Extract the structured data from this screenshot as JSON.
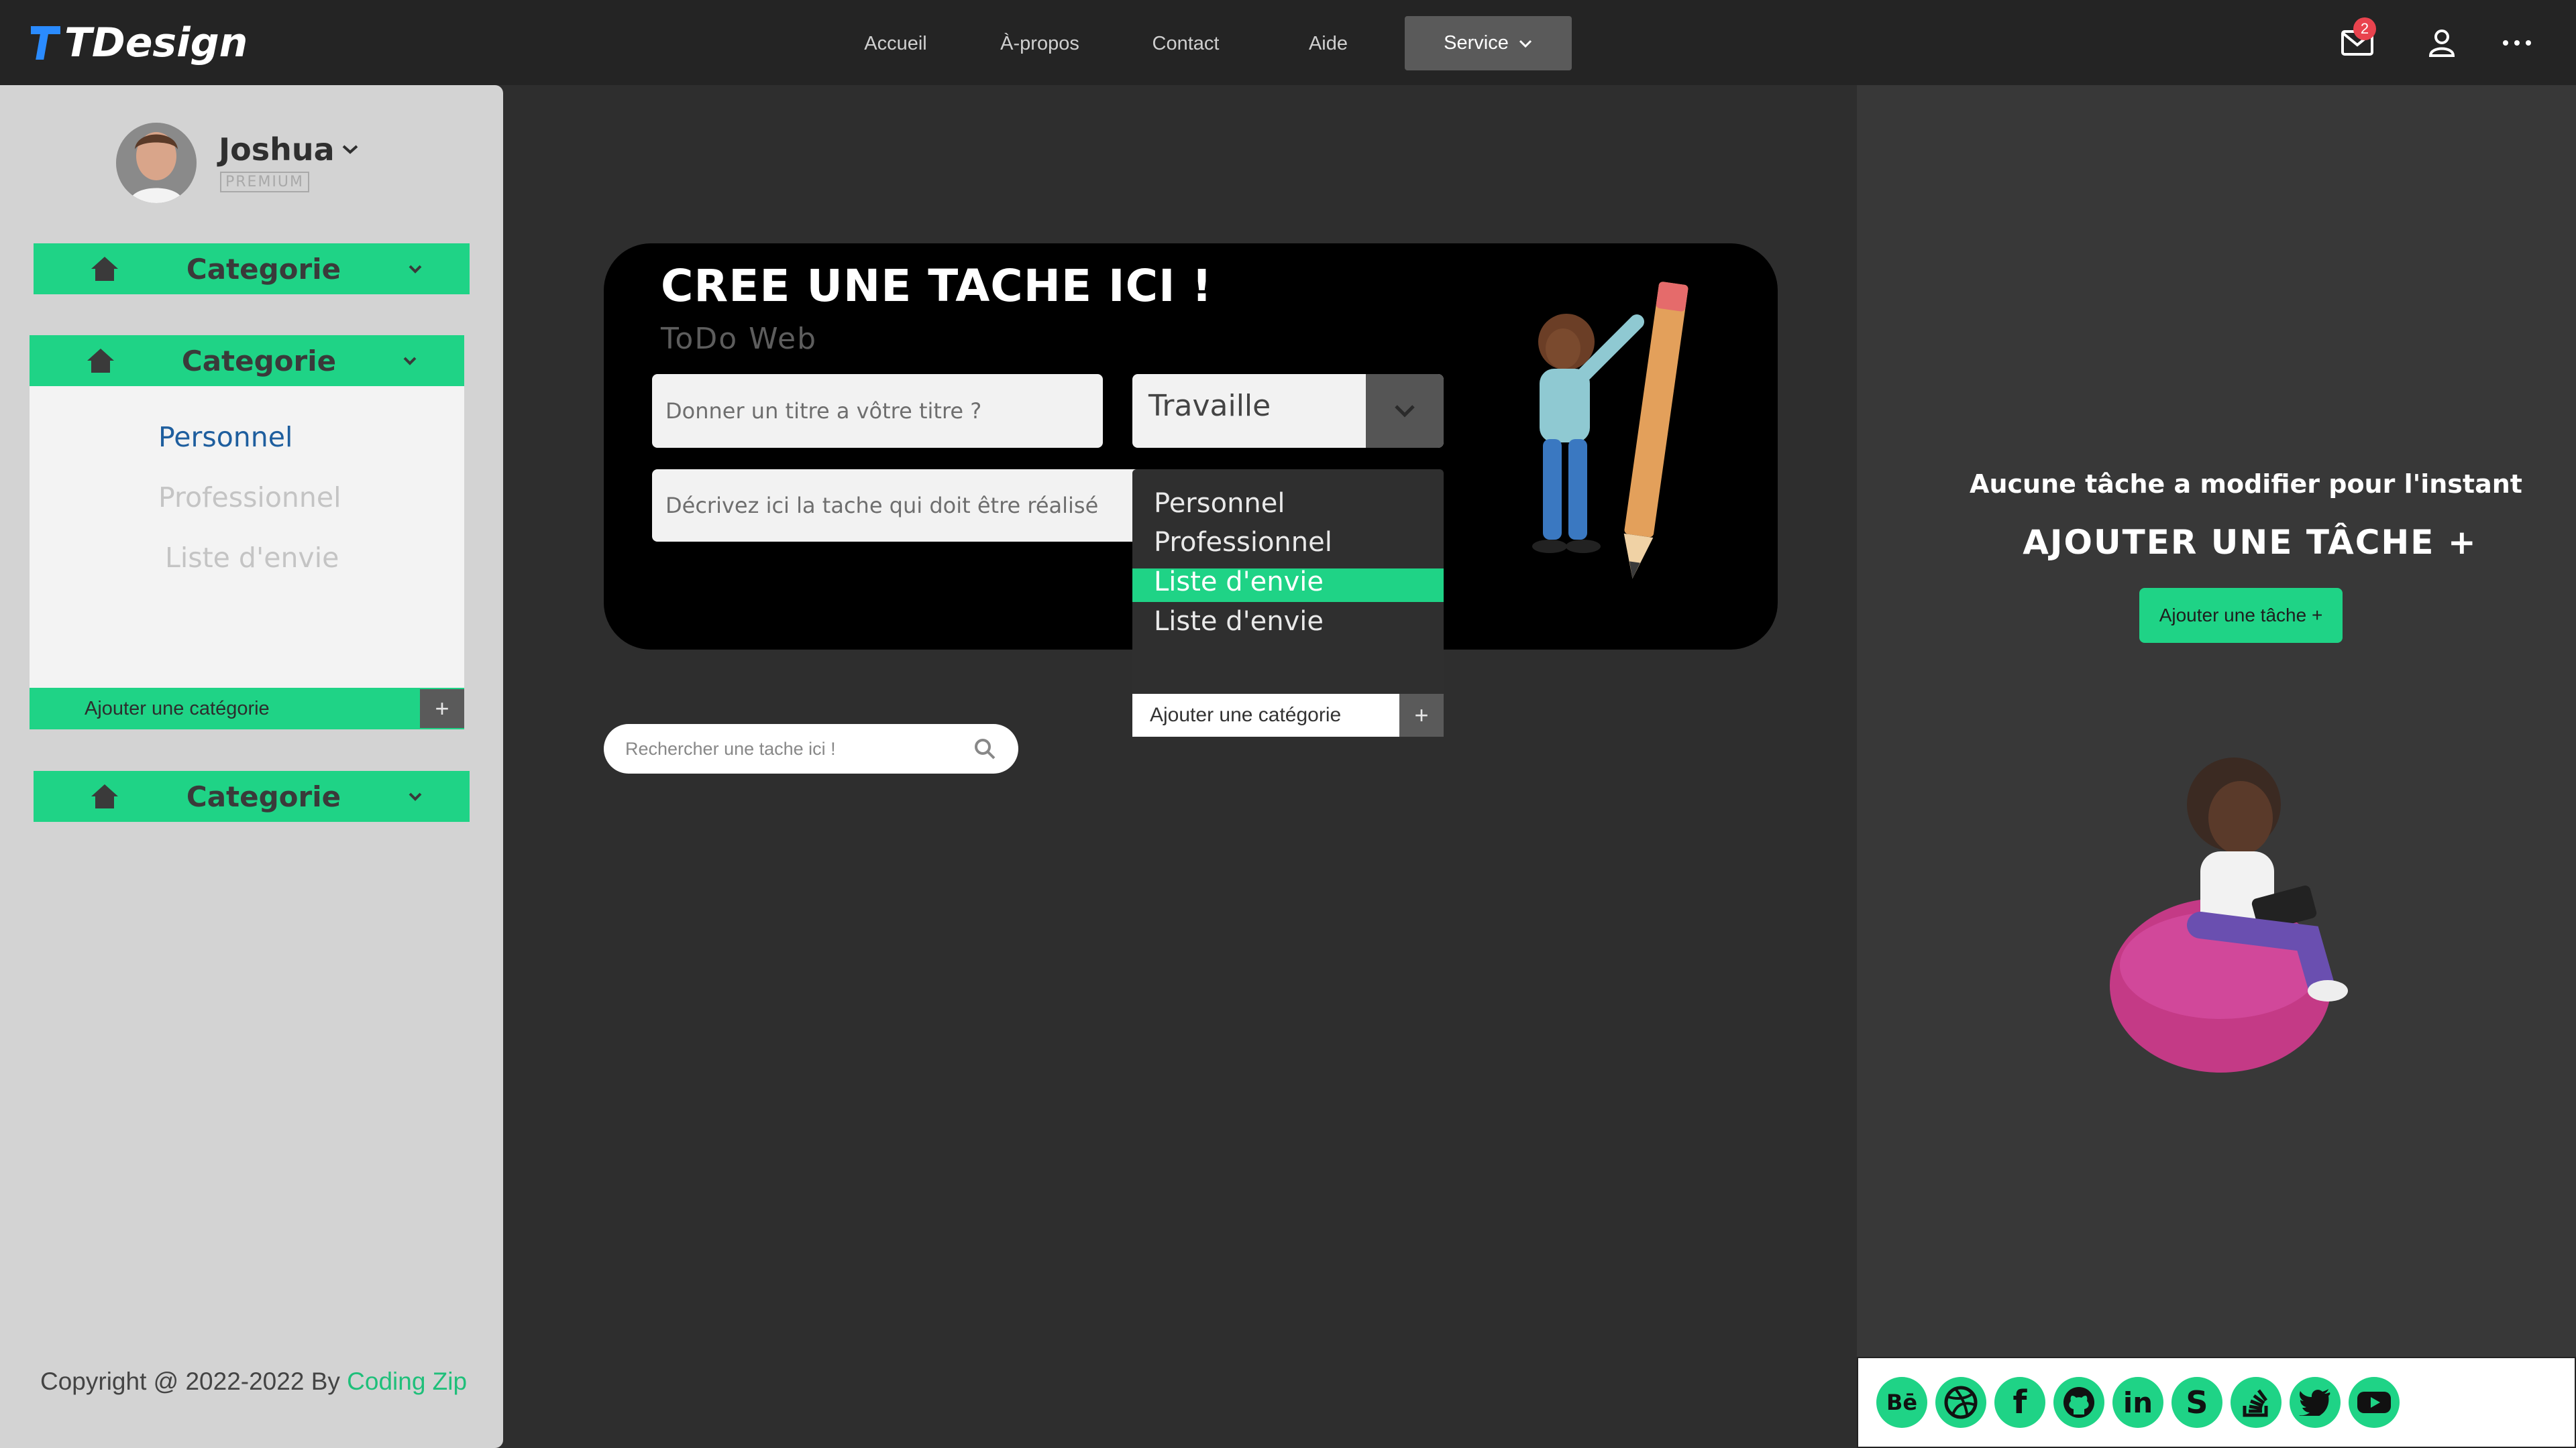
{
  "brand": {
    "name": "TDesign",
    "accent": "#1fd386",
    "badge_color": "#e9434e"
  },
  "nav": {
    "items": [
      "Accueil",
      "À-propos",
      "Contact",
      "Aide"
    ],
    "service_label": "Service",
    "mail_badge": "2"
  },
  "user": {
    "name": "Joshua",
    "tier": "PREMIUM"
  },
  "sidebar": {
    "category_label": "Categorie",
    "options": [
      "Personnel",
      "Professionnel",
      "Liste d'envie"
    ],
    "add_category": "Ajouter une catégorie",
    "plus": "+"
  },
  "footer": {
    "copyright": "Copyright @ 2022-2022 By ",
    "author": "Coding Zip"
  },
  "task_form": {
    "title": "CREE UNE TACHE ICI !",
    "subtitle": "ToDo Web",
    "title_placeholder": "Donner un titre a vôtre titre ?",
    "desc_placeholder": "Décrivez ici la tache qui doit être réalisé",
    "category_selected": "Travaille",
    "dropdown_options": [
      "Personnel",
      "Professionnel",
      "Liste d'envie",
      "Liste d'envie"
    ],
    "dropdown_add": "Ajouter une catégorie",
    "plus": "+"
  },
  "search": {
    "placeholder": "Rechercher une tache ici !"
  },
  "right_panel": {
    "empty_message": "Aucune tâche a modifier pour l'instant",
    "add_title": "AJOUTER UNE TÂCHE +",
    "add_button": "Ajouter une tâche +"
  },
  "social": [
    "behance-icon",
    "dribbble-icon",
    "facebook-icon",
    "github-icon",
    "linkedin-icon",
    "skype-icon",
    "stackoverflow-icon",
    "twitter-icon",
    "youtube-icon"
  ]
}
